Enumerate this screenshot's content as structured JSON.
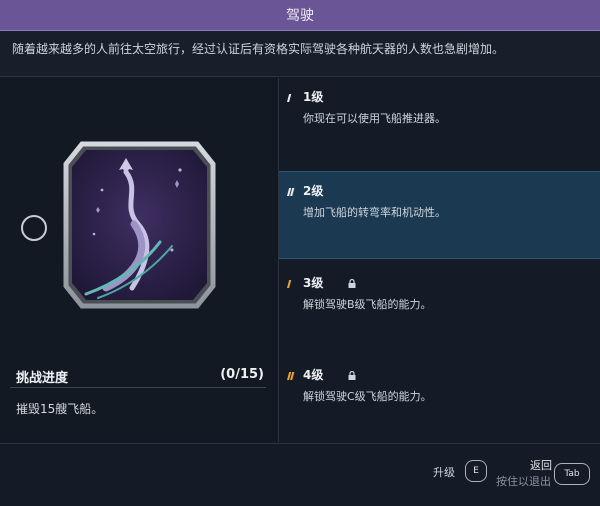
{
  "header": {
    "title": "驾驶"
  },
  "description": "随着越来越多的人前往太空旅行，经过认证后有资格实际驾驶各种航天器的人数也急剧增加。",
  "progress": {
    "title": "挑战进度",
    "count": "(0/15)",
    "task": "摧毁15艘飞船。"
  },
  "levels": [
    {
      "bars": "I",
      "title": "1级",
      "text": "你现在可以使用飞船推进器。",
      "locked": false,
      "active": false
    },
    {
      "bars": "II",
      "title": "2级",
      "text": "增加飞船的转弯率和机动性。",
      "locked": false,
      "active": true
    },
    {
      "bars": "I",
      "title": "3级",
      "text": "解锁驾驶B级飞船的能力。",
      "locked": true,
      "active": false
    },
    {
      "bars": "II",
      "title": "4级",
      "text": "解锁驾驶C级飞船的能力。",
      "locked": true,
      "active": false
    }
  ],
  "footer": {
    "upgrade_label": "升级",
    "upgrade_key": "E",
    "back_label": "返回",
    "back_hint": "按住以退出",
    "back_key": "Tab"
  },
  "colors": {
    "header_bg": "#6a5596",
    "active_bg": "#1b3a52",
    "level_bar_white": "#e8eaed",
    "level_bar_orange": "#f0a030"
  },
  "icons": {
    "lock": "lock-icon",
    "badge": "rocket-badge-icon"
  }
}
